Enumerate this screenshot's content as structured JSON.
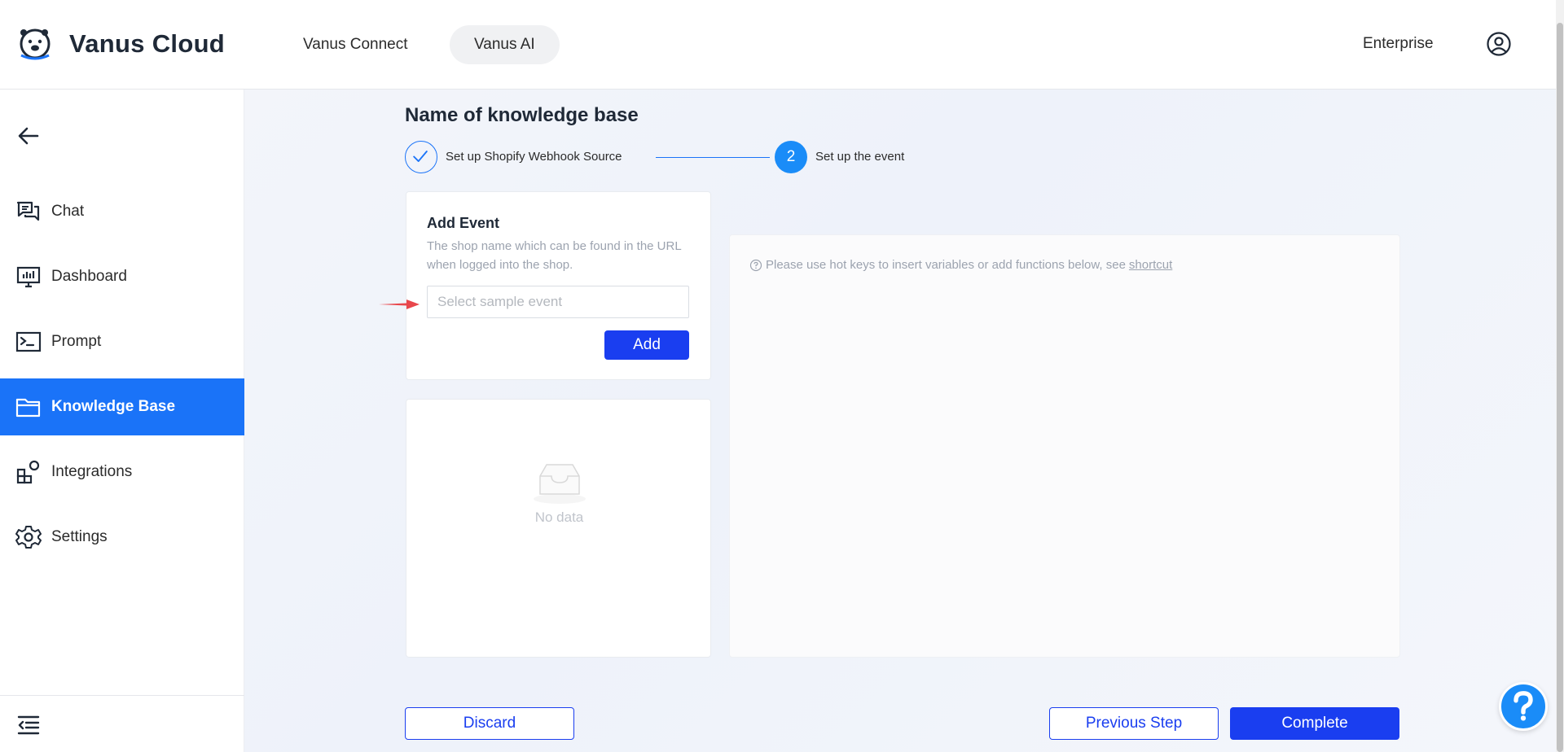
{
  "header": {
    "brand": "Vanus Cloud",
    "tabs": [
      {
        "label": "Vanus Connect",
        "active": false
      },
      {
        "label": "Vanus AI",
        "active": true
      }
    ],
    "plan": "Enterprise"
  },
  "sidebar": {
    "items": [
      {
        "label": "Chat",
        "icon": "chat-icon",
        "active": false
      },
      {
        "label": "Dashboard",
        "icon": "dashboard-icon",
        "active": false
      },
      {
        "label": "Prompt",
        "icon": "prompt-icon",
        "active": false
      },
      {
        "label": "Knowledge Base",
        "icon": "folder-icon",
        "active": true
      },
      {
        "label": "Integrations",
        "icon": "integrations-icon",
        "active": false
      },
      {
        "label": "Settings",
        "icon": "settings-icon",
        "active": false
      }
    ]
  },
  "main": {
    "title": "Name of knowledge base",
    "steps": [
      {
        "label": "Set up Shopify Webhook Source",
        "status": "done"
      },
      {
        "number": "2",
        "label": "Set up the event",
        "status": "current"
      }
    ],
    "add_event": {
      "title": "Add Event",
      "description": "The shop name which can be found in the URL when logged into the shop.",
      "placeholder": "Select sample event",
      "add_label": "Add"
    },
    "empty_text": "No data",
    "editor": {
      "hint": "Please use hot keys to insert variables or add functions below, see",
      "link": "shortcut"
    },
    "footer": {
      "discard_label": "Discard",
      "previous_label": "Previous Step",
      "complete_label": "Complete"
    }
  },
  "colors": {
    "primary": "#1a3ef0",
    "accent": "#1a73f8",
    "step_active": "#1a8cf8"
  }
}
